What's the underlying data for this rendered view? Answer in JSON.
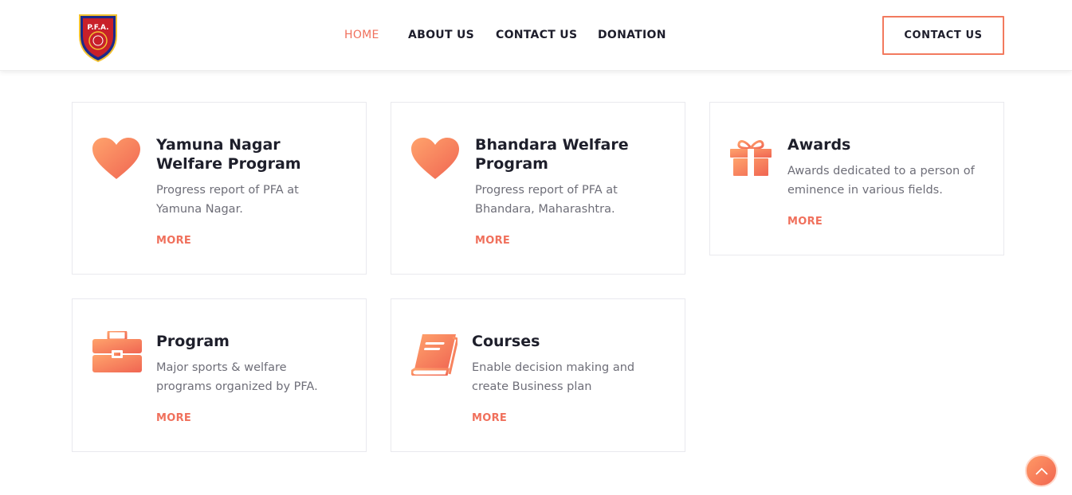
{
  "header": {
    "logo_text": "P.F.A.",
    "nav": [
      {
        "label": "HOME",
        "active": true
      },
      {
        "label": "ABOUT US",
        "active": false
      },
      {
        "label": "CONTACT US",
        "active": false
      },
      {
        "label": "DONATION",
        "active": false
      }
    ],
    "cta_label": "CONTACT US"
  },
  "cards": [
    {
      "icon": "heart-icon",
      "title_line1": "Yamuna Nagar",
      "title_line2": "Welfare Program",
      "desc_line1": "Progress report of PFA at",
      "desc_line2": "Yamuna Nagar.",
      "more": "MORE"
    },
    {
      "icon": "heart-icon",
      "title_line1": "Bhandara Welfare",
      "title_line2": "Program",
      "desc_line1": "Progress report of PFA at",
      "desc_line2": "Bhandara, Maharashtra.",
      "more": "MORE"
    },
    {
      "icon": "gift-icon",
      "title_line1": "Awards",
      "title_line2": "",
      "desc_line1": "Awards dedicated to a person of",
      "desc_line2": "eminence in various fields.",
      "more": "MORE"
    },
    {
      "icon": "briefcase-icon",
      "title_line1": "Program",
      "title_line2": "",
      "desc_line1": "Major sports & welfare",
      "desc_line2": "programs organized by PFA.",
      "more": "MORE"
    },
    {
      "icon": "book-icon",
      "title_line1": "Courses",
      "title_line2": "",
      "desc_line1": "Enable decision making and",
      "desc_line2": "create Business plan",
      "more": "MORE"
    }
  ],
  "colors": {
    "accent": "#f0705c",
    "gradient_start": "#ff9966",
    "gradient_end": "#f16650"
  }
}
